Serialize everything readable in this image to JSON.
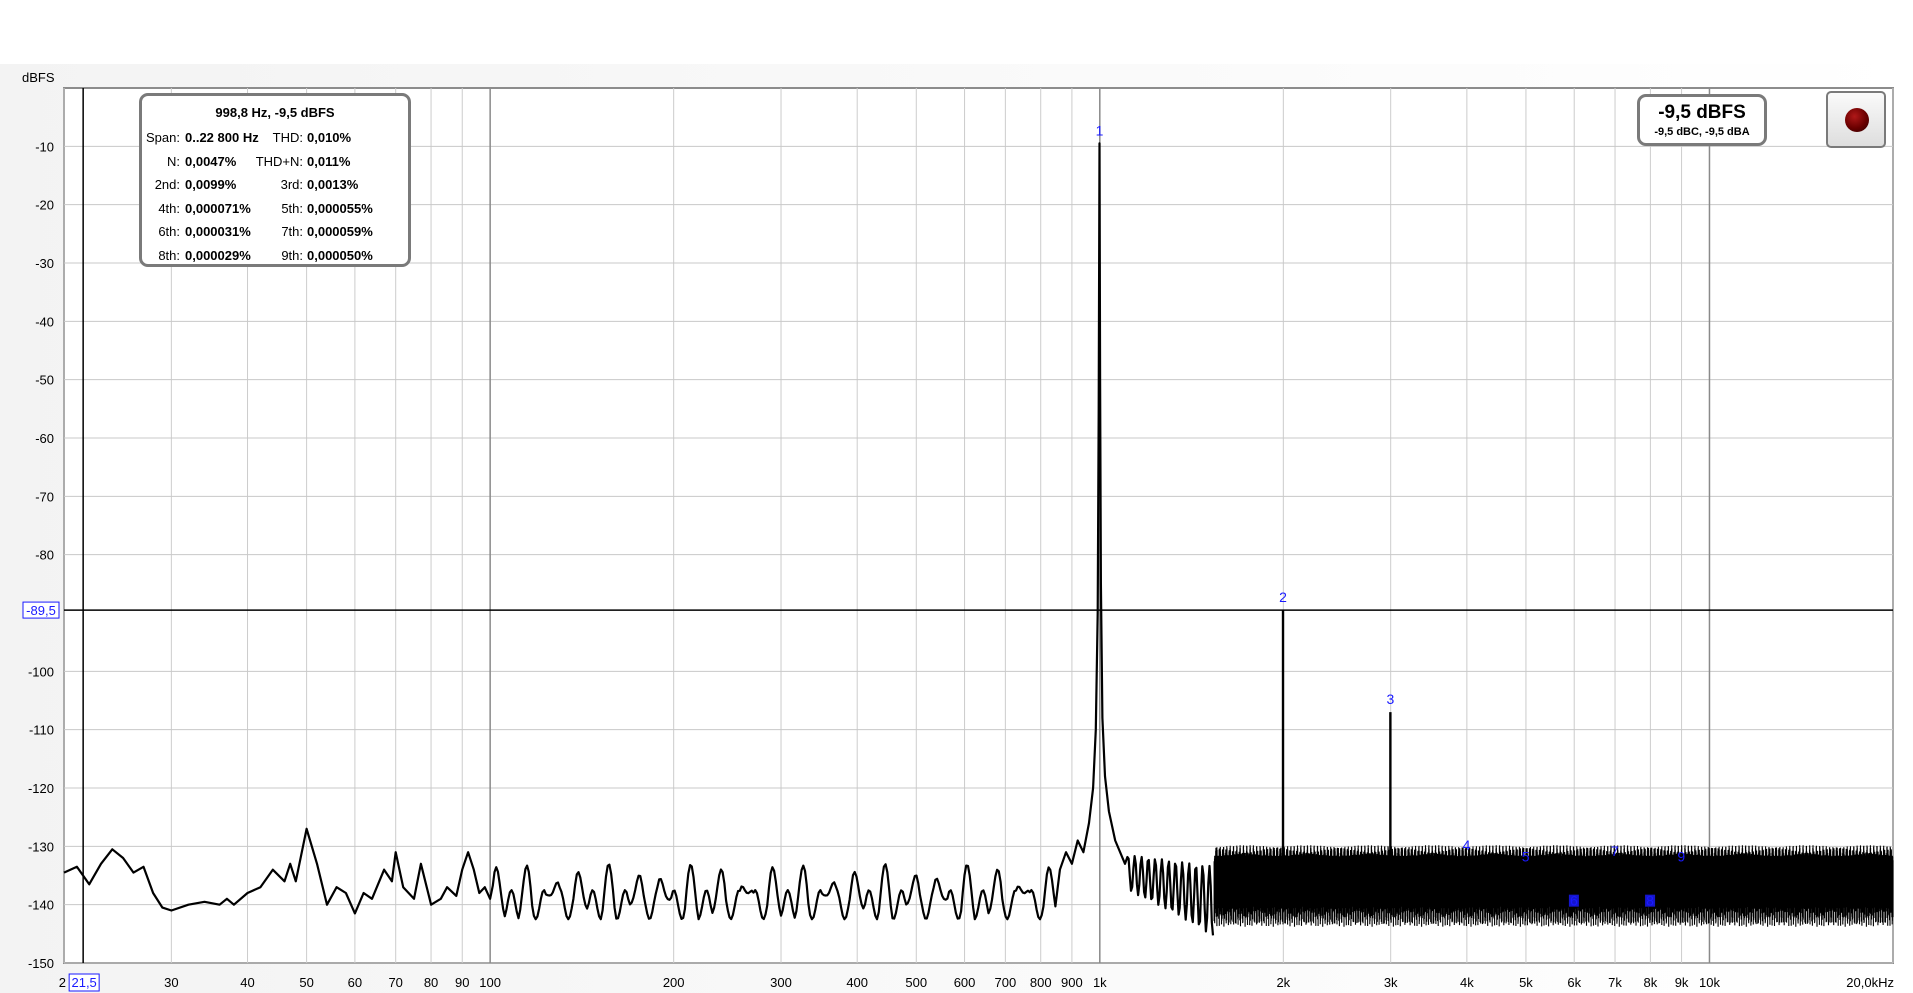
{
  "stats": {
    "header": "998,8 Hz, -9,5 dBFS",
    "rows": [
      {
        "l1": "Span:",
        "v1": "0..22 800 Hz",
        "l2": "THD:",
        "v2": "0,010%"
      },
      {
        "l1": "N:",
        "v1": "0,0047%",
        "l2": "THD+N:",
        "v2": "0,011%"
      },
      {
        "l1": "2nd:",
        "v1": "0,0099%",
        "l2": "3rd:",
        "v2": "0,0013%"
      },
      {
        "l1": "4th:",
        "v1": "0,000071%",
        "l2": "5th:",
        "v2": "0,000055%"
      },
      {
        "l1": "6th:",
        "v1": "0,000031%",
        "l2": "7th:",
        "v2": "0,000059%"
      },
      {
        "l1": "8th:",
        "v1": "0,000029%",
        "l2": "9th:",
        "v2": "0,000050%"
      }
    ]
  },
  "level": {
    "main": "-9,5 dBFS",
    "sub": "-9,5 dBC, -9,5 dBA"
  },
  "record_button": {
    "icon": "record-icon",
    "color": "#8b0000"
  },
  "chart_data": {
    "type": "line",
    "title": "",
    "ylabel": "dBFS",
    "xlabel": "",
    "x_scale": "log",
    "xlim": [
      20,
      20000
    ],
    "ylim": [
      -150,
      0
    ],
    "grid": true,
    "y_ticks": [
      {
        "v": -10,
        "label": "-10"
      },
      {
        "v": -20,
        "label": "-20"
      },
      {
        "v": -30,
        "label": "-30"
      },
      {
        "v": -40,
        "label": "-40"
      },
      {
        "v": -50,
        "label": "-50"
      },
      {
        "v": -60,
        "label": "-60"
      },
      {
        "v": -70,
        "label": "-70"
      },
      {
        "v": -80,
        "label": "-80"
      },
      {
        "v": -100,
        "label": "-100"
      },
      {
        "v": -110,
        "label": "-110"
      },
      {
        "v": -120,
        "label": "-120"
      },
      {
        "v": -130,
        "label": "-130"
      },
      {
        "v": -140,
        "label": "-140"
      },
      {
        "v": -150,
        "label": "-150"
      }
    ],
    "x_ticks": [
      {
        "v": 20,
        "label": "2"
      },
      {
        "v": 30,
        "label": "30"
      },
      {
        "v": 40,
        "label": "40"
      },
      {
        "v": 50,
        "label": "50"
      },
      {
        "v": 60,
        "label": "60"
      },
      {
        "v": 70,
        "label": "70"
      },
      {
        "v": 80,
        "label": "80"
      },
      {
        "v": 90,
        "label": "90"
      },
      {
        "v": 100,
        "label": "100"
      },
      {
        "v": 200,
        "label": "200"
      },
      {
        "v": 300,
        "label": "300"
      },
      {
        "v": 400,
        "label": "400"
      },
      {
        "v": 500,
        "label": "500"
      },
      {
        "v": 600,
        "label": "600"
      },
      {
        "v": 700,
        "label": "700"
      },
      {
        "v": 800,
        "label": "800"
      },
      {
        "v": 900,
        "label": "900"
      },
      {
        "v": 1000,
        "label": "1k"
      },
      {
        "v": 2000,
        "label": "2k"
      },
      {
        "v": 3000,
        "label": "3k"
      },
      {
        "v": 4000,
        "label": "4k"
      },
      {
        "v": 5000,
        "label": "5k"
      },
      {
        "v": 6000,
        "label": "6k"
      },
      {
        "v": 7000,
        "label": "7k"
      },
      {
        "v": 8000,
        "label": "8k"
      },
      {
        "v": 9000,
        "label": "9k"
      },
      {
        "v": 10000,
        "label": "10k"
      },
      {
        "v": 20000,
        "label": "20,0kHz"
      }
    ],
    "cursor": {
      "x_value": 21.5,
      "x_label": "21,5",
      "y_value": -89.5,
      "y_label": "-89,5"
    },
    "harmonics": [
      {
        "label": "1",
        "freq": 998.8,
        "db": -9.5
      },
      {
        "label": "2",
        "freq": 1997.6,
        "db": -89.5
      },
      {
        "label": "3",
        "freq": 2996.4,
        "db": -107
      },
      {
        "label": "4",
        "freq": 3995.2,
        "db": -132
      },
      {
        "label": "5",
        "freq": 4994,
        "db": -134
      },
      {
        "label": "6",
        "freq": 5992.8,
        "db": -140
      },
      {
        "label": "7",
        "freq": 6991.6,
        "db": -133
      },
      {
        "label": "8",
        "freq": 7990.4,
        "db": -140
      },
      {
        "label": "9",
        "freq": 8989.2,
        "db": -134
      }
    ],
    "series": [
      {
        "points": [
          [
            20,
            -134.5
          ],
          [
            21,
            -133.5
          ],
          [
            22,
            -136.5
          ],
          [
            23,
            -133
          ],
          [
            24,
            -130.5
          ],
          [
            25,
            -132
          ],
          [
            26,
            -134.5
          ],
          [
            27,
            -133.5
          ],
          [
            28,
            -138
          ],
          [
            29,
            -140.5
          ],
          [
            30,
            -141
          ],
          [
            32,
            -140
          ],
          [
            34,
            -139.5
          ],
          [
            36,
            -140
          ],
          [
            37,
            -139
          ],
          [
            38,
            -140
          ],
          [
            40,
            -138
          ],
          [
            42,
            -137
          ],
          [
            44,
            -134
          ],
          [
            46,
            -136
          ],
          [
            47,
            -133
          ],
          [
            48,
            -136
          ],
          [
            50,
            -127
          ],
          [
            52,
            -133
          ],
          [
            54,
            -140
          ],
          [
            56,
            -137
          ],
          [
            58,
            -138
          ],
          [
            60,
            -141.5
          ],
          [
            62,
            -138
          ],
          [
            64,
            -139
          ],
          [
            67,
            -134
          ],
          [
            69,
            -136
          ],
          [
            70,
            -131
          ],
          [
            72,
            -137
          ],
          [
            75,
            -139
          ],
          [
            77,
            -133
          ],
          [
            80,
            -140
          ],
          [
            83,
            -139
          ],
          [
            85,
            -137
          ],
          [
            88,
            -138.5
          ],
          [
            90,
            -134
          ],
          [
            92,
            -131
          ],
          [
            94,
            -134
          ],
          [
            96,
            -138
          ],
          [
            98,
            -137
          ],
          [
            100,
            -139
          ]
        ]
      }
    ]
  }
}
